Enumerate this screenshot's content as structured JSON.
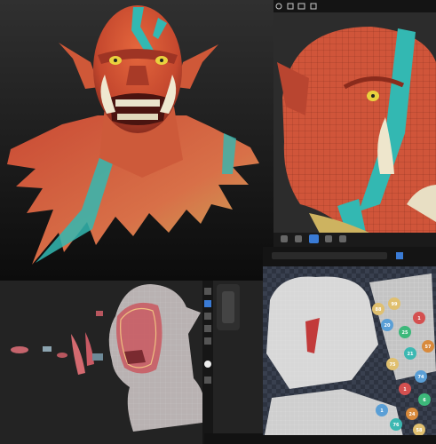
{
  "render_panel": {},
  "closeup_panel": {
    "toolbar_icons": [
      "gear-icon",
      "grid-icon",
      "image-icon",
      "square-icon"
    ],
    "tab_icons": [
      "brush-icon",
      "layers-icon",
      "topology-icon",
      "material-icon",
      "camera-icon"
    ]
  },
  "retopo_panel": {
    "tools": [
      "move-icon",
      "brush-icon",
      "pen-icon",
      "select-icon",
      "mask-icon",
      "light-icon",
      "gear-icon"
    ]
  },
  "uv_panel": {
    "chips": [
      "88",
      "99",
      "20",
      "25",
      "1",
      "57",
      "21",
      "75",
      "74",
      "1",
      "6",
      "24",
      "76",
      "58",
      "1"
    ]
  },
  "colors": {
    "skin": "#d4553c",
    "warpaint": "#33b8b2",
    "wireframe": "#d9d9d9",
    "ui_dark": "#2b2b2b"
  }
}
